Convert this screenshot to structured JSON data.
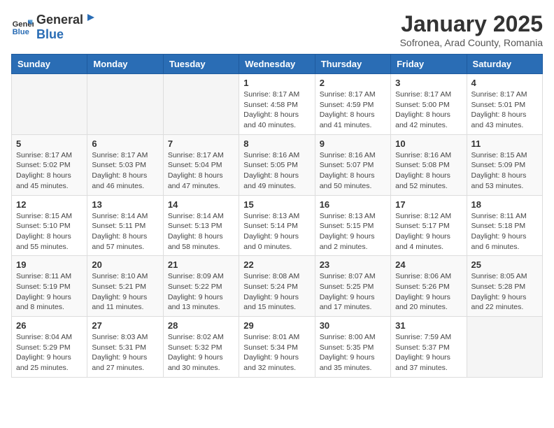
{
  "logo": {
    "general": "General",
    "blue": "Blue"
  },
  "header": {
    "title": "January 2025",
    "subtitle": "Sofronea, Arad County, Romania"
  },
  "weekdays": [
    "Sunday",
    "Monday",
    "Tuesday",
    "Wednesday",
    "Thursday",
    "Friday",
    "Saturday"
  ],
  "weeks": [
    [
      {
        "day": "",
        "info": ""
      },
      {
        "day": "",
        "info": ""
      },
      {
        "day": "",
        "info": ""
      },
      {
        "day": "1",
        "info": "Sunrise: 8:17 AM\nSunset: 4:58 PM\nDaylight: 8 hours and 40 minutes."
      },
      {
        "day": "2",
        "info": "Sunrise: 8:17 AM\nSunset: 4:59 PM\nDaylight: 8 hours and 41 minutes."
      },
      {
        "day": "3",
        "info": "Sunrise: 8:17 AM\nSunset: 5:00 PM\nDaylight: 8 hours and 42 minutes."
      },
      {
        "day": "4",
        "info": "Sunrise: 8:17 AM\nSunset: 5:01 PM\nDaylight: 8 hours and 43 minutes."
      }
    ],
    [
      {
        "day": "5",
        "info": "Sunrise: 8:17 AM\nSunset: 5:02 PM\nDaylight: 8 hours and 45 minutes."
      },
      {
        "day": "6",
        "info": "Sunrise: 8:17 AM\nSunset: 5:03 PM\nDaylight: 8 hours and 46 minutes."
      },
      {
        "day": "7",
        "info": "Sunrise: 8:17 AM\nSunset: 5:04 PM\nDaylight: 8 hours and 47 minutes."
      },
      {
        "day": "8",
        "info": "Sunrise: 8:16 AM\nSunset: 5:05 PM\nDaylight: 8 hours and 49 minutes."
      },
      {
        "day": "9",
        "info": "Sunrise: 8:16 AM\nSunset: 5:07 PM\nDaylight: 8 hours and 50 minutes."
      },
      {
        "day": "10",
        "info": "Sunrise: 8:16 AM\nSunset: 5:08 PM\nDaylight: 8 hours and 52 minutes."
      },
      {
        "day": "11",
        "info": "Sunrise: 8:15 AM\nSunset: 5:09 PM\nDaylight: 8 hours and 53 minutes."
      }
    ],
    [
      {
        "day": "12",
        "info": "Sunrise: 8:15 AM\nSunset: 5:10 PM\nDaylight: 8 hours and 55 minutes."
      },
      {
        "day": "13",
        "info": "Sunrise: 8:14 AM\nSunset: 5:11 PM\nDaylight: 8 hours and 57 minutes."
      },
      {
        "day": "14",
        "info": "Sunrise: 8:14 AM\nSunset: 5:13 PM\nDaylight: 8 hours and 58 minutes."
      },
      {
        "day": "15",
        "info": "Sunrise: 8:13 AM\nSunset: 5:14 PM\nDaylight: 9 hours and 0 minutes."
      },
      {
        "day": "16",
        "info": "Sunrise: 8:13 AM\nSunset: 5:15 PM\nDaylight: 9 hours and 2 minutes."
      },
      {
        "day": "17",
        "info": "Sunrise: 8:12 AM\nSunset: 5:17 PM\nDaylight: 9 hours and 4 minutes."
      },
      {
        "day": "18",
        "info": "Sunrise: 8:11 AM\nSunset: 5:18 PM\nDaylight: 9 hours and 6 minutes."
      }
    ],
    [
      {
        "day": "19",
        "info": "Sunrise: 8:11 AM\nSunset: 5:19 PM\nDaylight: 9 hours and 8 minutes."
      },
      {
        "day": "20",
        "info": "Sunrise: 8:10 AM\nSunset: 5:21 PM\nDaylight: 9 hours and 11 minutes."
      },
      {
        "day": "21",
        "info": "Sunrise: 8:09 AM\nSunset: 5:22 PM\nDaylight: 9 hours and 13 minutes."
      },
      {
        "day": "22",
        "info": "Sunrise: 8:08 AM\nSunset: 5:24 PM\nDaylight: 9 hours and 15 minutes."
      },
      {
        "day": "23",
        "info": "Sunrise: 8:07 AM\nSunset: 5:25 PM\nDaylight: 9 hours and 17 minutes."
      },
      {
        "day": "24",
        "info": "Sunrise: 8:06 AM\nSunset: 5:26 PM\nDaylight: 9 hours and 20 minutes."
      },
      {
        "day": "25",
        "info": "Sunrise: 8:05 AM\nSunset: 5:28 PM\nDaylight: 9 hours and 22 minutes."
      }
    ],
    [
      {
        "day": "26",
        "info": "Sunrise: 8:04 AM\nSunset: 5:29 PM\nDaylight: 9 hours and 25 minutes."
      },
      {
        "day": "27",
        "info": "Sunrise: 8:03 AM\nSunset: 5:31 PM\nDaylight: 9 hours and 27 minutes."
      },
      {
        "day": "28",
        "info": "Sunrise: 8:02 AM\nSunset: 5:32 PM\nDaylight: 9 hours and 30 minutes."
      },
      {
        "day": "29",
        "info": "Sunrise: 8:01 AM\nSunset: 5:34 PM\nDaylight: 9 hours and 32 minutes."
      },
      {
        "day": "30",
        "info": "Sunrise: 8:00 AM\nSunset: 5:35 PM\nDaylight: 9 hours and 35 minutes."
      },
      {
        "day": "31",
        "info": "Sunrise: 7:59 AM\nSunset: 5:37 PM\nDaylight: 9 hours and 37 minutes."
      },
      {
        "day": "",
        "info": ""
      }
    ]
  ]
}
